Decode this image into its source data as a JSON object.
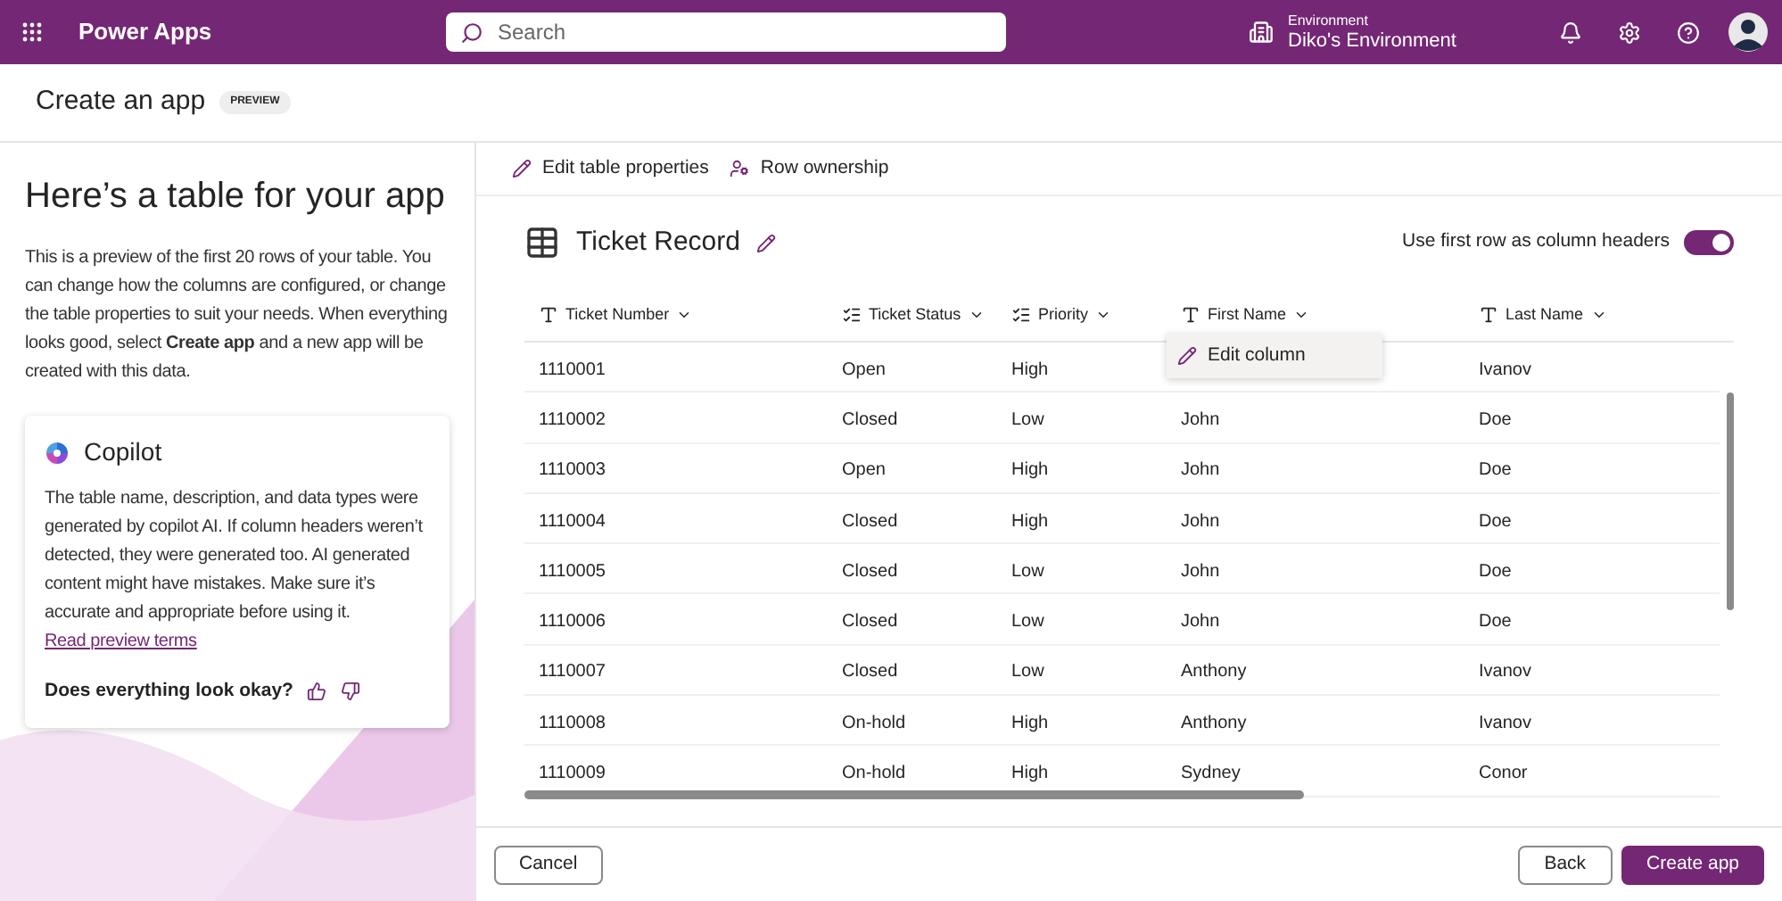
{
  "topbar": {
    "app_name": "Power Apps",
    "search": {
      "placeholder": "Search"
    },
    "environment": {
      "label": "Environment",
      "name": "Diko's Environment"
    }
  },
  "page": {
    "title": "Create an app",
    "badge": "PREVIEW"
  },
  "left": {
    "heading": "Here’s a table for your app",
    "intro": "This is a preview of the first 20 rows of your table. You can change how the columns are configured, or change the table properties to suit your needs. When everything looks good, select **Create app** and a new app will be created with this data.",
    "copilot": {
      "title": "Copilot",
      "text": "The table name, description, and data types were generated by copilot AI. If column headers weren’t detected, they were generated too. AI generated content might have mistakes. Make sure it’s accurate and appropriate before using it.",
      "link": "Read preview terms",
      "feedback": "Does everything look okay?"
    }
  },
  "toolbar": [
    "Edit table properties",
    "Row ownership"
  ],
  "table": {
    "name": "Ticket Record",
    "header_toggle": {
      "label": "Use first row as column headers",
      "on": true
    },
    "columns": [
      {
        "label": "Ticket Number",
        "kind": "text"
      },
      {
        "label": "Ticket Status",
        "kind": "choice"
      },
      {
        "label": "Priority",
        "kind": "choice"
      },
      {
        "label": "First Name",
        "kind": "text"
      },
      {
        "label": "Last Name",
        "kind": "text"
      }
    ],
    "rows": [
      [
        "1110001",
        "Open",
        "High",
        null,
        "Ivanov"
      ],
      [
        "1110002",
        "Closed",
        "Low",
        "John",
        "Doe"
      ],
      [
        "1110003",
        "Open",
        "High",
        "John",
        "Doe"
      ],
      [
        "1110004",
        "Closed",
        "High",
        "John",
        "Doe"
      ],
      [
        "1110005",
        "Closed",
        "Low",
        "John",
        "Doe"
      ],
      [
        "1110006",
        "Closed",
        "Low",
        "John",
        "Doe"
      ],
      [
        "1110007",
        "Closed",
        "Low",
        "Anthony",
        "Ivanov"
      ],
      [
        "1110008",
        "On-hold",
        "High",
        "Anthony",
        "Ivanov"
      ],
      [
        "1110009",
        "On-hold",
        "High",
        "Sydney",
        "Conor"
      ]
    ],
    "column_menu": {
      "item": "Edit column"
    }
  },
  "footer": {
    "cancel": "Cancel",
    "back": "Back",
    "create": "Create app"
  }
}
